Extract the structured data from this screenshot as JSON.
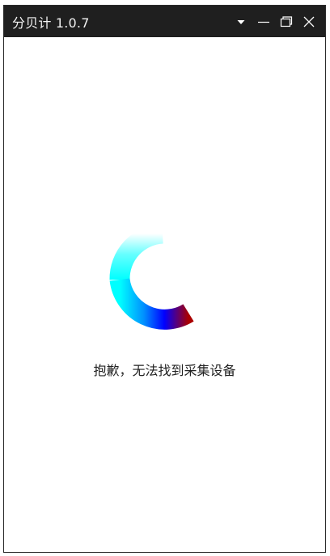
{
  "window": {
    "title": "分贝计 1.0.7",
    "controls": {
      "menu": "chevron-down-icon",
      "minimize": "minimize-icon",
      "maximize": "restore-icon",
      "close": "close-icon"
    }
  },
  "status": {
    "message": "抱歉，无法找到采集设备"
  },
  "colors": {
    "titlebar": "#1f1f1f",
    "spinner_start": "#ffffff",
    "spinner_cyan": "#00ffff",
    "spinner_blue": "#0000ff",
    "spinner_end": "#aa0000"
  }
}
